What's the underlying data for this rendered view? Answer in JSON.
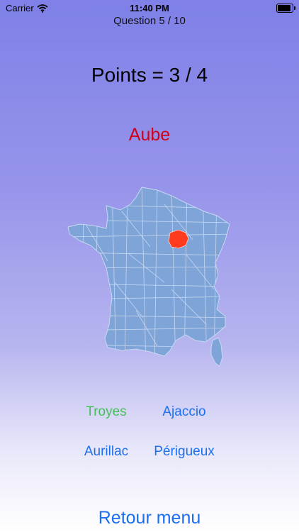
{
  "status_bar": {
    "carrier": "Carrier",
    "time": "11:40 PM"
  },
  "quiz": {
    "question_progress": "Question 5 / 10",
    "points": "Points = 3 / 4",
    "target_department": "Aube"
  },
  "answers": [
    {
      "label": "Troyes",
      "color": "#46c05a"
    },
    {
      "label": "Ajaccio",
      "color": "#1c6ff0"
    },
    {
      "label": "Aurillac",
      "color": "#1c6ff0"
    },
    {
      "label": "Périgueux",
      "color": "#1c6ff0"
    }
  ],
  "menu_button": "Retour menu",
  "colors": {
    "map_fill": "#7ea4d8",
    "highlight": "#ff3b1f",
    "accent": "#1c6ff0"
  }
}
